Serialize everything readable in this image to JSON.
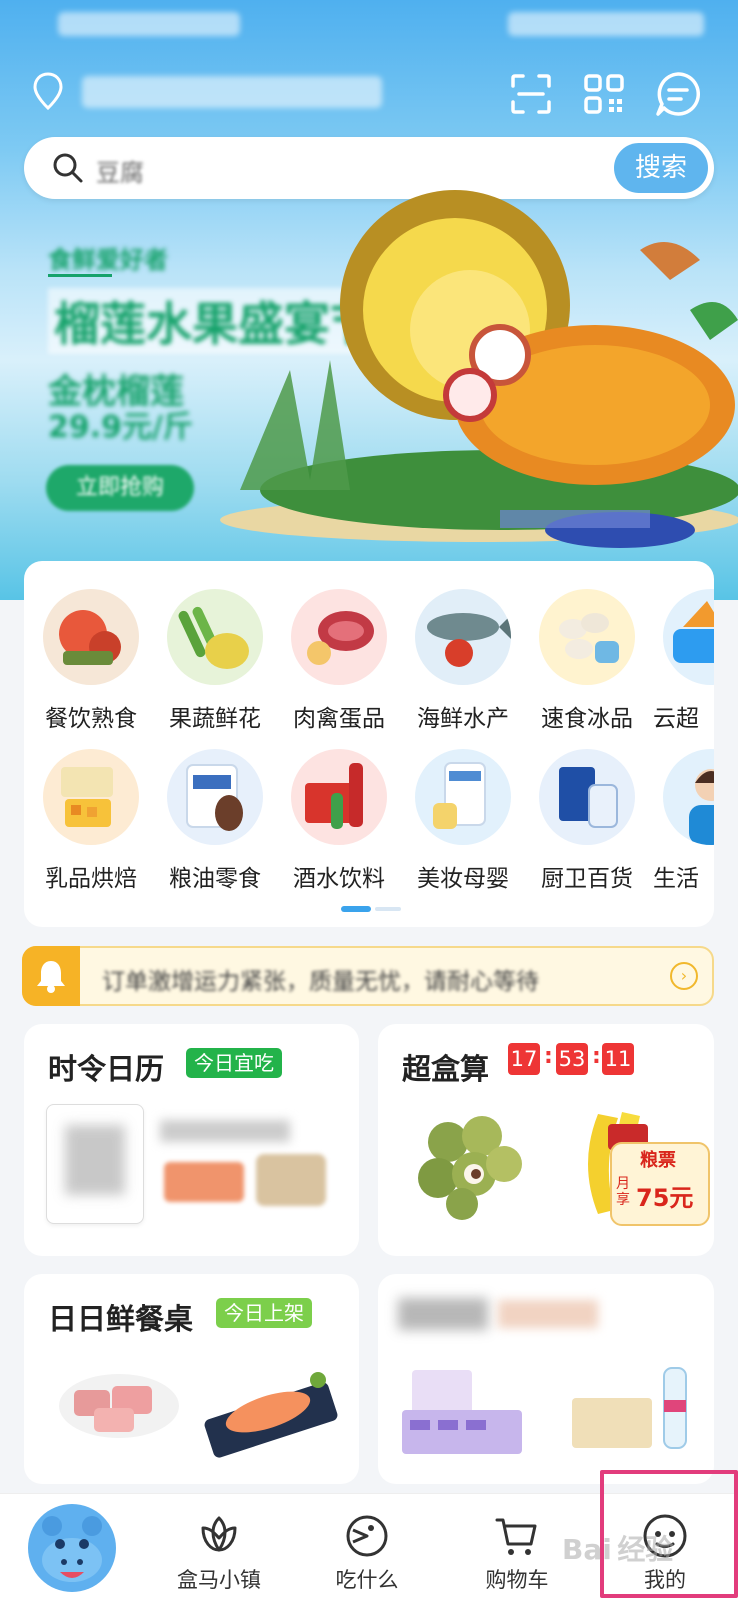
{
  "search": {
    "placeholder": "豆腐",
    "button_label": "搜索"
  },
  "banner": {
    "line1": "食鲜爱好者",
    "headline": "榴莲水果盛宴节",
    "line3": "金枕榴莲",
    "price": "29.9元/斤",
    "cta": "立即抢购"
  },
  "categories": [
    {
      "label": "餐饮熟食",
      "icon": "crayfish-food-icon",
      "color": "#f6e7d7"
    },
    {
      "label": "果蔬鲜花",
      "icon": "vegetables-icon",
      "color": "#e7f3d9"
    },
    {
      "label": "肉禽蛋品",
      "icon": "meat-icon",
      "color": "#fde3e1"
    },
    {
      "label": "海鲜水产",
      "icon": "seafood-icon",
      "color": "#e1eef8"
    },
    {
      "label": "速食冰品",
      "icon": "dumplings-icon",
      "color": "#fff3cf"
    },
    {
      "label": "云超",
      "icon": "cloud-market-icon",
      "color": "#e2f1fc"
    },
    {
      "label": "乳品烘焙",
      "icon": "dairy-bakery-icon",
      "color": "#fdebd3"
    },
    {
      "label": "粮油零食",
      "icon": "grain-snack-icon",
      "color": "#e7f0fb"
    },
    {
      "label": "酒水饮料",
      "icon": "drinks-icon",
      "color": "#fde3e1"
    },
    {
      "label": "美妆母婴",
      "icon": "baby-care-icon",
      "color": "#e2f1fc"
    },
    {
      "label": "厨卫百货",
      "icon": "household-icon",
      "color": "#e7f0fb"
    },
    {
      "label": "生活",
      "icon": "service-person-icon",
      "color": "#e2f1fc"
    }
  ],
  "notice": {
    "text": "订单激增运力紧张，质量无忧，请耐心等待"
  },
  "panels": {
    "calendar": {
      "title": "时令日历",
      "tag": "今日宜吃"
    },
    "deals": {
      "title": "超盒算",
      "timer": [
        "17",
        "53",
        "11"
      ],
      "badge_top": "粮票",
      "badge_bottom": "月享",
      "badge_amount": "75元"
    },
    "fresh_table": {
      "title": "日日鲜餐桌",
      "tag": "今日上架"
    }
  },
  "tabbar": {
    "items": [
      {
        "label": "",
        "icon": "hippo-mascot-icon"
      },
      {
        "label": "盒马小镇",
        "icon": "lotus-icon"
      },
      {
        "label": "吃什么",
        "icon": "food-face-icon"
      },
      {
        "label": "购物车",
        "icon": "cart-icon"
      },
      {
        "label": "我的",
        "icon": "profile-face-icon"
      }
    ]
  },
  "colors": {
    "accent": "#5fb5ee",
    "green": "#1ea86a",
    "timer_red": "#ee3535",
    "highlight": "#e23c7c"
  }
}
